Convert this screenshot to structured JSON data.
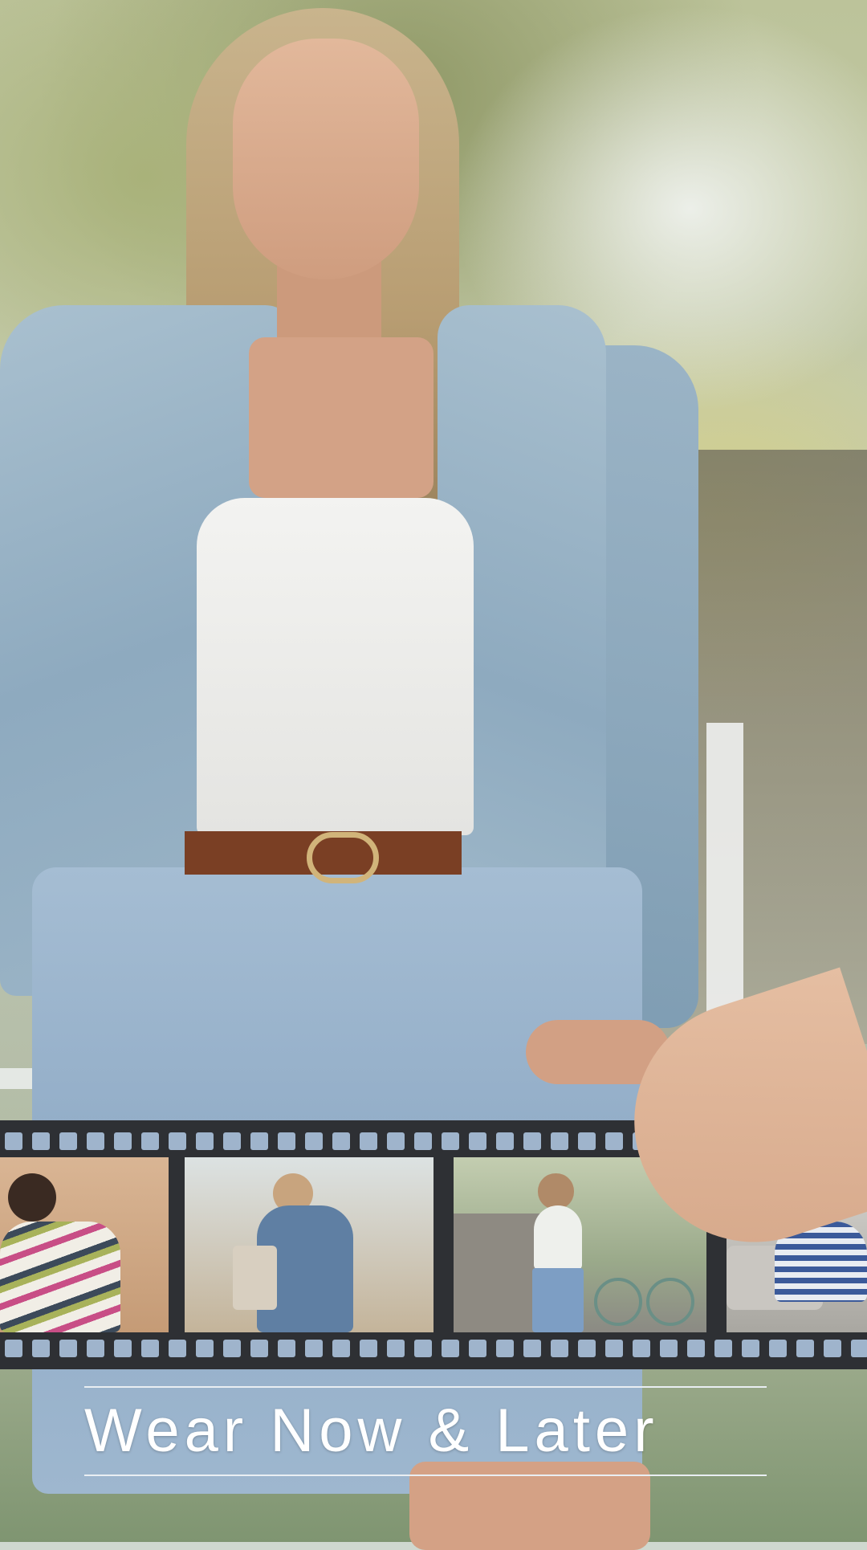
{
  "headline": {
    "text": "Wear Now & Later"
  },
  "colors": {
    "film_strip": "#2e3034",
    "sprocket_hole": "#9fb4cc",
    "headline": "#ffffff"
  },
  "film_strip": {
    "frames": [
      {
        "name": "striped-sweater-frame"
      },
      {
        "name": "denim-dress-frame"
      },
      {
        "name": "bicycle-frame"
      },
      {
        "name": "striped-top-frame"
      }
    ]
  }
}
